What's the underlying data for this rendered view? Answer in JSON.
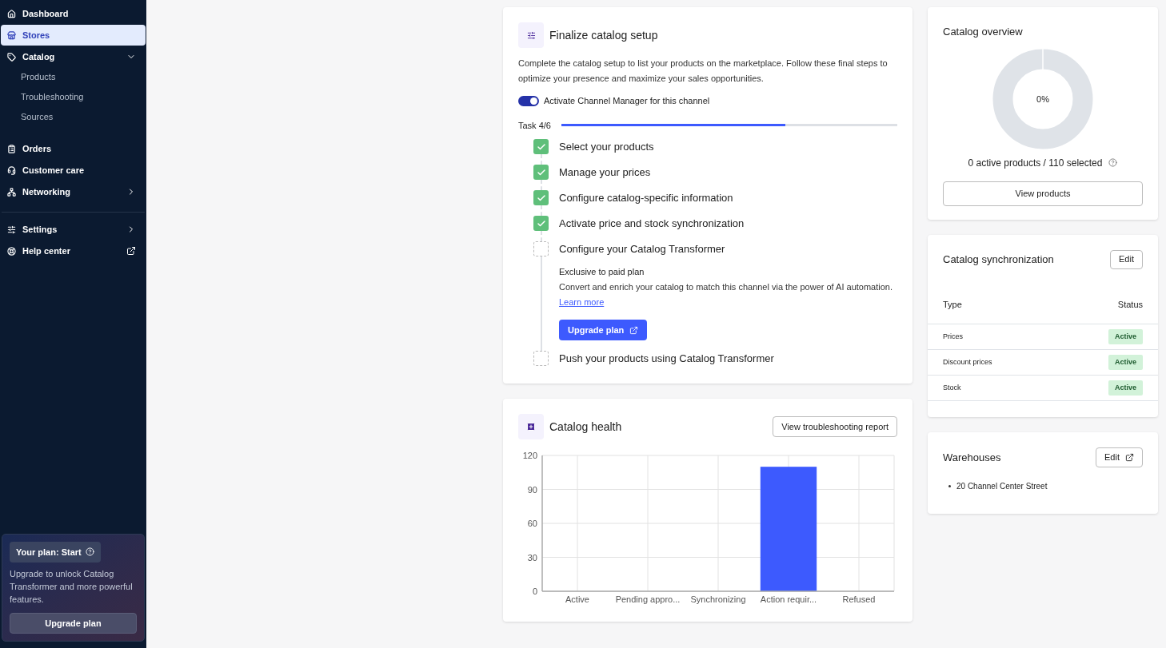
{
  "sidebar": {
    "items": [
      {
        "label": "Dashboard",
        "selected": false,
        "kind": "plain"
      },
      {
        "label": "Stores",
        "selected": true,
        "kind": "plain"
      },
      {
        "label": "Catalog",
        "selected": false,
        "kind": "expand",
        "expanded": true,
        "children": [
          {
            "label": "Products",
            "selected": false
          },
          {
            "label": "Troubleshooting",
            "selected": false
          },
          {
            "label": "Sources",
            "selected": false
          }
        ]
      },
      {
        "label": "Orders",
        "selected": false,
        "kind": "plain"
      },
      {
        "label": "Customer care",
        "selected": false,
        "kind": "plain"
      },
      {
        "label": "Networking",
        "selected": false,
        "kind": "submenu"
      }
    ],
    "bottom_items": [
      {
        "label": "Settings",
        "selected": false,
        "kind": "submenu"
      },
      {
        "label": "Help center",
        "selected": false,
        "kind": "external"
      }
    ],
    "plan": {
      "badge": "Your plan: Start",
      "text": "Upgrade to unlock Catalog Transformer and more powerful features.",
      "button": "Upgrade plan"
    }
  },
  "setup": {
    "title": "Finalize catalog setup",
    "description": "Complete the catalog setup to list your products on the marketplace. Follow these final steps to optimize your presence and maximize your sales opportunities.",
    "toggle": {
      "label": "Activate Channel Manager for this channel",
      "on": true
    },
    "progress": {
      "label": "Task 4/6",
      "level": 0.667
    },
    "tasks": [
      {
        "label": "Select your products",
        "done": true
      },
      {
        "label": "Manage your prices",
        "done": true
      },
      {
        "label": "Configure catalog-specific information",
        "done": true
      },
      {
        "label": "Activate price and stock synchronization",
        "done": true
      },
      {
        "label": "Configure your Catalog Transformer",
        "done": false,
        "detail": {
          "note": "Exclusive to paid plan",
          "text": "Convert and enrich your catalog to match this channel via the power of AI automation.",
          "link": "Learn more",
          "button": "Upgrade plan"
        }
      },
      {
        "label": "Push your products using Catalog Transformer",
        "done": false
      }
    ]
  },
  "health": {
    "title": "Catalog health",
    "button": "View troubleshooting report",
    "chart_data": {
      "type": "bar",
      "categories": [
        "Active",
        "Pending appro...",
        "Synchronizing",
        "Action requir...",
        "Refused"
      ],
      "series": [
        {
          "color": "#3d5afe",
          "values": [
            0,
            0,
            0,
            110,
            0
          ]
        }
      ],
      "ylim": [
        0,
        120
      ],
      "yticks": [
        0,
        30,
        60,
        90,
        120
      ],
      "grid": true
    }
  },
  "overview": {
    "title": "Catalog overview",
    "center": "0%",
    "level": 0,
    "caption": "0 active products / 110 selected",
    "button": "View products"
  },
  "sync": {
    "title": "Catalog synchronization",
    "button": "Edit",
    "columns": [
      "Type",
      "Status"
    ],
    "rows": [
      {
        "type": "Prices",
        "status": "Active"
      },
      {
        "type": "Discount prices",
        "status": "Active"
      },
      {
        "type": "Stock",
        "status": "Active"
      }
    ]
  },
  "warehouses": {
    "title": "Warehouses",
    "button": "Edit",
    "items": [
      "20 Channel Center Street"
    ]
  }
}
